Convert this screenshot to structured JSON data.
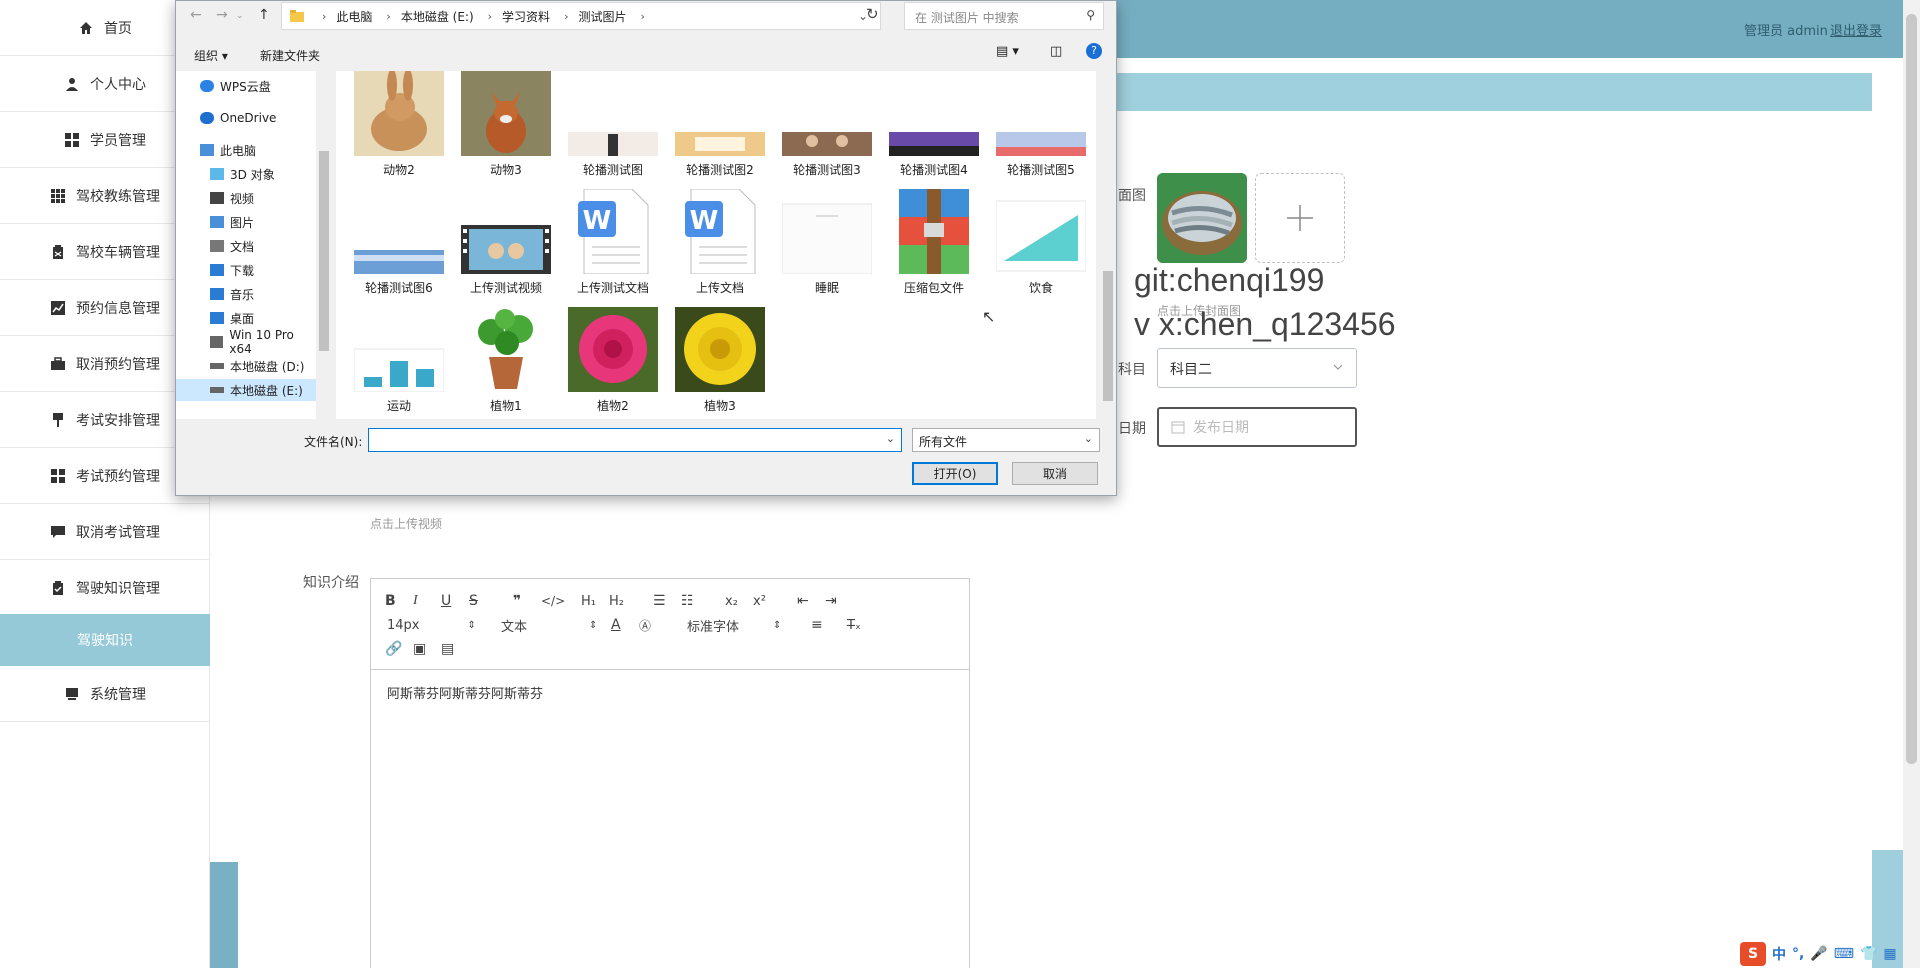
{
  "sidebar": {
    "items": [
      {
        "label": "首页",
        "icon": "home-icon"
      },
      {
        "label": "个人中心",
        "icon": "user-icon"
      },
      {
        "label": "学员管理",
        "icon": "grid-icon"
      },
      {
        "label": "驾校教练管理",
        "icon": "grid-icon"
      },
      {
        "label": "驾校车辆管理",
        "icon": "clipboard-icon"
      },
      {
        "label": "预约信息管理",
        "icon": "chart-icon"
      },
      {
        "label": "取消预约管理",
        "icon": "briefcase-icon"
      },
      {
        "label": "考试安排管理",
        "icon": "pin-icon"
      },
      {
        "label": "考试预约管理",
        "icon": "grid-icon"
      },
      {
        "label": "取消考试管理",
        "icon": "comment-icon"
      },
      {
        "label": "驾驶知识管理",
        "icon": "clipboard-check-icon"
      },
      {
        "label": "驾驶知识",
        "icon": ""
      },
      {
        "label": "系统管理",
        "icon": "monitor-icon"
      }
    ]
  },
  "header": {
    "admin_label": "管理员 admin",
    "logout_label": "退出登录"
  },
  "form": {
    "cover_label": "面图",
    "cover_hint": "点击上传封面图",
    "subject_label": "科目",
    "subject_value": "科目二",
    "date_label": "日期",
    "date_placeholder": "发布日期",
    "upload_video_hint": "点击上传视频",
    "knowledge_label": "知识介绍"
  },
  "watermark": {
    "line1": "git:chenqi199",
    "line2": "v x:chen_q123456"
  },
  "editor": {
    "font_size": "14px",
    "block_type": "文本",
    "font_family": "标准字体",
    "content": "阿斯蒂芬阿斯蒂芬阿斯蒂芬"
  },
  "dialog": {
    "breadcrumbs": [
      "此电脑",
      "本地磁盘 (E:)",
      "学习资料",
      "测试图片"
    ],
    "search_placeholder": "在 测试图片 中搜索",
    "organize_label": "组织 ▾",
    "new_folder_label": "新建文件夹",
    "tree": [
      {
        "label": "WPS云盘",
        "color": "#2a82e4"
      },
      {
        "label": "OneDrive",
        "color": "#1e6fd0"
      },
      {
        "label": "此电脑",
        "color": "#4a90d9"
      },
      {
        "label": "3D 对象",
        "color": "#5bb8e8"
      },
      {
        "label": "视频",
        "color": "#444"
      },
      {
        "label": "图片",
        "color": "#4a90d9"
      },
      {
        "label": "文档",
        "color": "#777"
      },
      {
        "label": "下载",
        "color": "#2a7bd3"
      },
      {
        "label": "音乐",
        "color": "#2a7bd3"
      },
      {
        "label": "桌面",
        "color": "#2a7bd3"
      },
      {
        "label": "Win 10 Pro x64",
        "color": "#666"
      },
      {
        "label": "本地磁盘 (D:)",
        "color": "#666"
      },
      {
        "label": "本地磁盘 (E:)",
        "color": "#666"
      }
    ],
    "files": [
      {
        "label": "动物2",
        "kind": "rabbit"
      },
      {
        "label": "动物3",
        "kind": "fox"
      },
      {
        "label": "轮播测试图",
        "kind": "banner"
      },
      {
        "label": "轮播测试图2",
        "kind": "banner"
      },
      {
        "label": "轮播测试图3",
        "kind": "banner"
      },
      {
        "label": "轮播测试图4",
        "kind": "banner"
      },
      {
        "label": "轮播测试图5",
        "kind": "banner"
      },
      {
        "label": "轮播测试图6",
        "kind": "banner"
      },
      {
        "label": "上传测试视频",
        "kind": "video"
      },
      {
        "label": "上传测试文档",
        "kind": "word"
      },
      {
        "label": "上传文档",
        "kind": "word"
      },
      {
        "label": "睡眠",
        "kind": "blank"
      },
      {
        "label": "压缩包文件",
        "kind": "zip"
      },
      {
        "label": "饮食",
        "kind": "chart-area"
      },
      {
        "label": "运动",
        "kind": "chart-bar"
      },
      {
        "label": "植物1",
        "kind": "plant"
      },
      {
        "label": "植物2",
        "kind": "rose"
      },
      {
        "label": "植物3",
        "kind": "chrysanthemum"
      }
    ],
    "filename_label": "文件名(N):",
    "filename_value": "",
    "filetype_value": "所有文件",
    "open_label": "打开(O)",
    "cancel_label": "取消"
  },
  "ime": {
    "lang": "中"
  }
}
